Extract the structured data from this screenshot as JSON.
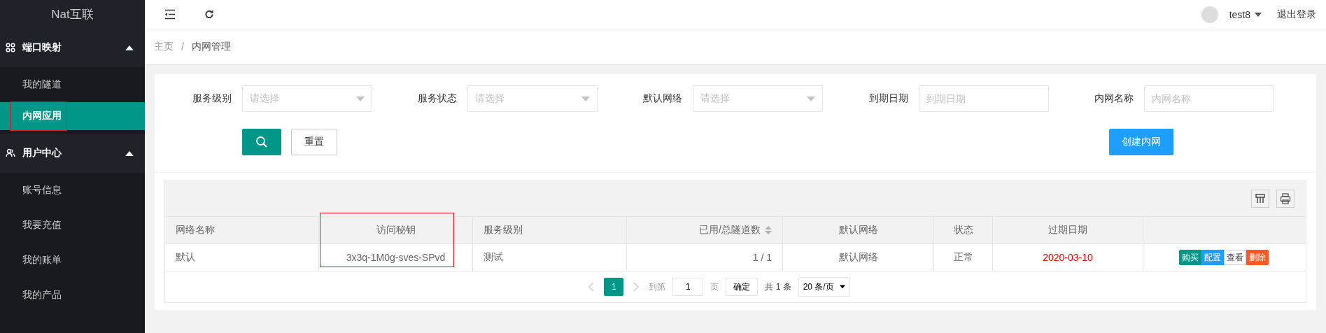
{
  "sidebar": {
    "logo": "Nat互联",
    "groups": [
      {
        "label": "端口映射",
        "expanded": true,
        "items": [
          {
            "label": "我的隧道",
            "selected": false,
            "annotated": false
          },
          {
            "label": "内网应用",
            "selected": true,
            "annotated": true
          }
        ]
      },
      {
        "label": "用户中心",
        "expanded": true,
        "items": [
          {
            "label": "账号信息",
            "selected": false,
            "annotated": false
          },
          {
            "label": "我要充值",
            "selected": false,
            "annotated": false
          },
          {
            "label": "我的账单",
            "selected": false,
            "annotated": false
          },
          {
            "label": "我的产品",
            "selected": false,
            "annotated": false
          }
        ]
      }
    ]
  },
  "header": {
    "user": "test8",
    "logout": "退出登录"
  },
  "breadcrumb": {
    "items": [
      "主页",
      "内网管理"
    ],
    "separator": "/"
  },
  "filters": [
    {
      "label": "服务级别",
      "kind": "select",
      "placeholder": "请选择"
    },
    {
      "label": "服务状态",
      "kind": "select",
      "placeholder": "请选择"
    },
    {
      "label": "默认网络",
      "kind": "select",
      "placeholder": "请选择"
    },
    {
      "label": "到期日期",
      "kind": "input",
      "placeholder": "到期日期"
    },
    {
      "label": "内网名称",
      "kind": "input",
      "placeholder": "内网名称"
    }
  ],
  "reset_button": "重置",
  "create_button": "创建内网",
  "table": {
    "columns": [
      {
        "label": "网络名称",
        "sortable": false,
        "annotated": false
      },
      {
        "label": "访问秘钥",
        "sortable": false,
        "annotated": true
      },
      {
        "label": "服务级别",
        "sortable": false,
        "annotated": false
      },
      {
        "label": "已用/总隧道数",
        "sortable": true,
        "annotated": false
      },
      {
        "label": "默认网络",
        "sortable": false,
        "annotated": false
      },
      {
        "label": "状态",
        "sortable": false,
        "annotated": false
      },
      {
        "label": "过期日期",
        "sortable": false,
        "annotated": false
      }
    ],
    "rows": [
      {
        "cells": [
          "默认",
          "3x3q-1M0g-sves-SPvd",
          "测试",
          "1 / 1",
          "默认网络",
          "正常",
          "2020-03-10"
        ],
        "expired": true,
        "actions": [
          {
            "label": "购买",
            "color": "#009688"
          },
          {
            "label": "配置",
            "color": "#1e9fff"
          },
          {
            "label": "查看",
            "color": "#ffffff"
          },
          {
            "label": "删除",
            "color": "#ff5722"
          }
        ]
      }
    ]
  },
  "pagination": {
    "pages": [
      {
        "label": "1",
        "selected": true
      }
    ],
    "goto_label": "到第",
    "goto_value": "1",
    "page_unit": "页",
    "confirm": "确定",
    "total": "共 1 条",
    "page_size": "20 条/页"
  }
}
